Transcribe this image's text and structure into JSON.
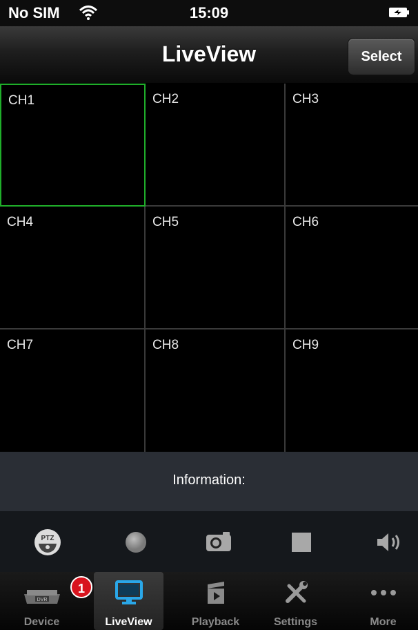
{
  "status_bar": {
    "carrier": "No SIM",
    "time": "15:09"
  },
  "navbar": {
    "title": "LiveView",
    "select_label": "Select"
  },
  "channels": [
    "CH1",
    "CH2",
    "CH3",
    "CH4",
    "CH5",
    "CH6",
    "CH7",
    "CH8",
    "CH9"
  ],
  "selected_channel": "CH1",
  "info": {
    "label": "Information:"
  },
  "controls": [
    "ptz-icon",
    "record-icon",
    "snapshot-icon",
    "stop-icon",
    "volume-icon"
  ],
  "tabs": [
    {
      "label": "Device",
      "icon": "dvr-icon",
      "badge": "1"
    },
    {
      "label": "LiveView",
      "icon": "monitor-icon",
      "active": true
    },
    {
      "label": "Playback",
      "icon": "playback-icon"
    },
    {
      "label": "Settings",
      "icon": "tools-icon"
    },
    {
      "label": "More",
      "icon": "more-dots-icon"
    }
  ],
  "colors": {
    "selection": "#1fae2a",
    "badge": "#d8141e",
    "active_icon": "#2aa7e8"
  }
}
